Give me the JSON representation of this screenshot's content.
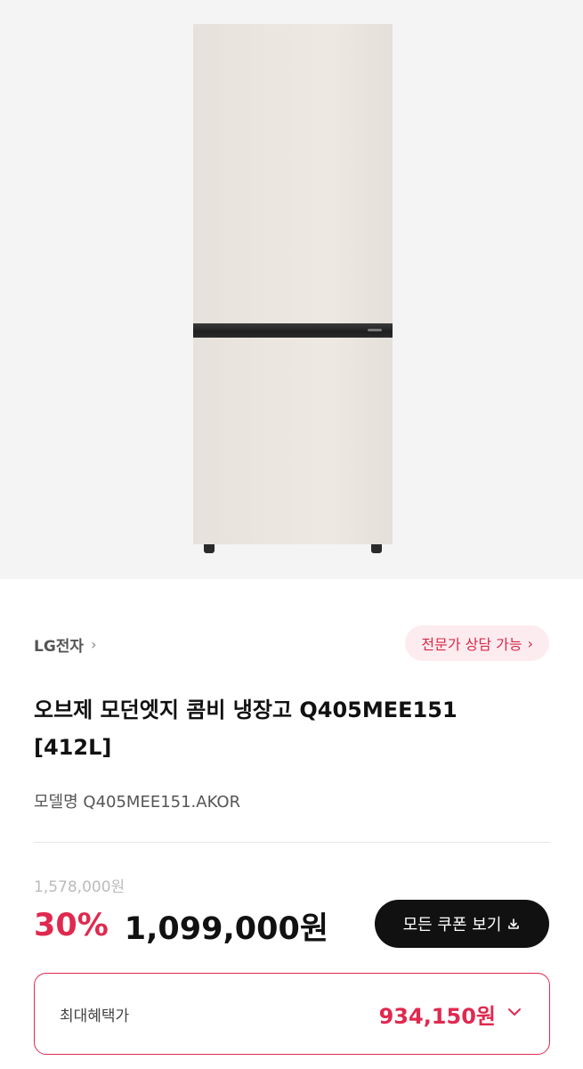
{
  "product": {
    "brand": "LG전자",
    "consult_label": "전문가 상담 가능",
    "title_line1": "오브제 모던엣지 콤비 냉장고 Q405MEE151",
    "title_line2": "[412L]",
    "model_label": "모델명 Q405MEE151.AKOR"
  },
  "pricing": {
    "original_price": "1,578,000원",
    "discount": "30%",
    "price": "1,099,000원",
    "coupon_button": "모든 쿠폰 보기",
    "max_benefit_label": "최대혜택가",
    "max_benefit_price": "934,150원"
  },
  "icons": {
    "brand_chevron": "chevron-right-icon",
    "consult_chevron": "chevron-right-icon",
    "coupon_download": "download-icon",
    "max_expand": "chevron-down-icon"
  },
  "colors": {
    "accent": "#e0294f",
    "consult_bg": "#fdecef",
    "coupon_bg": "#111111"
  }
}
